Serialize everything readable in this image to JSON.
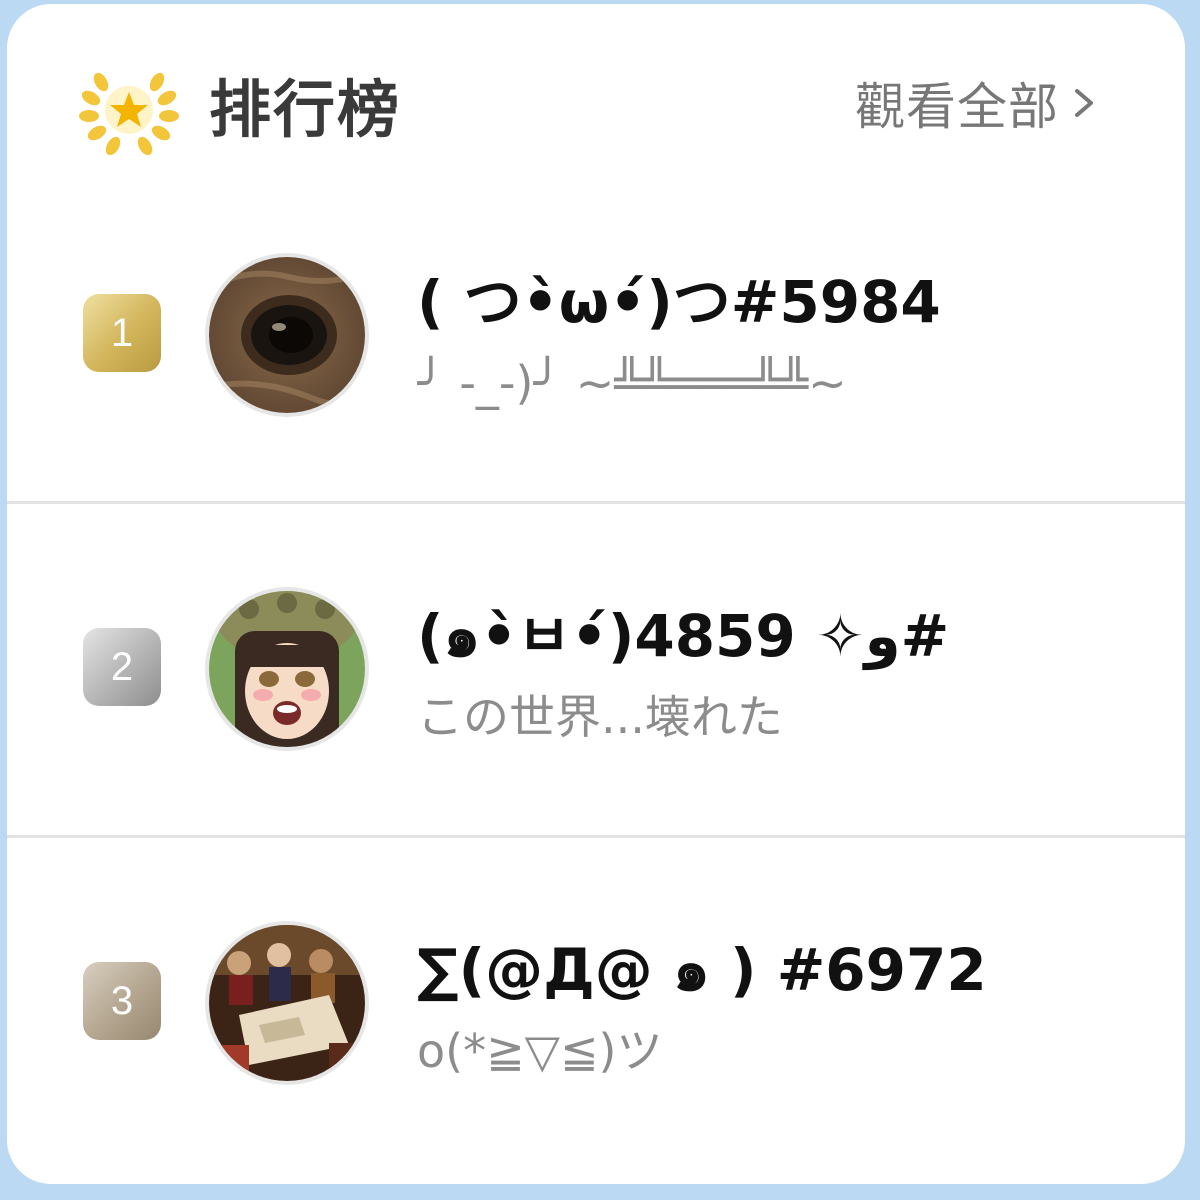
{
  "header": {
    "title": "排行榜",
    "view_all_label": "觀看全部",
    "icon": "laurel-star-icon",
    "chevron_icon": "chevron-right-icon"
  },
  "leaderboard": [
    {
      "rank": "1",
      "name": "( つ•̀ω•́)つ#5984",
      "subtitle": "╯ -_-)╯ ~╩╩═══╩╩~",
      "badge_color": "#cfb258",
      "avatar": "eye-closeup-avatar"
    },
    {
      "rank": "2",
      "name": " (๑•̀ㅂ•́)و✧ 4859#",
      "subtitle": "この世界...壊れた",
      "badge_color": "#a9a9a9",
      "avatar": "anime-girl-crying-avatar"
    },
    {
      "rank": "3",
      "name": "∑(@Д@ ๑ ) #6972",
      "subtitle": "o(*≧▽≦)ツ",
      "badge_color": "#ab9d87",
      "avatar": "tabletop-scene-avatar"
    }
  ],
  "colors": {
    "background": "#bcd9f3",
    "card": "#ffffff",
    "title": "#3a3a3a",
    "subtitle": "#8c8c8c",
    "accent_gold": "#f5b400"
  }
}
